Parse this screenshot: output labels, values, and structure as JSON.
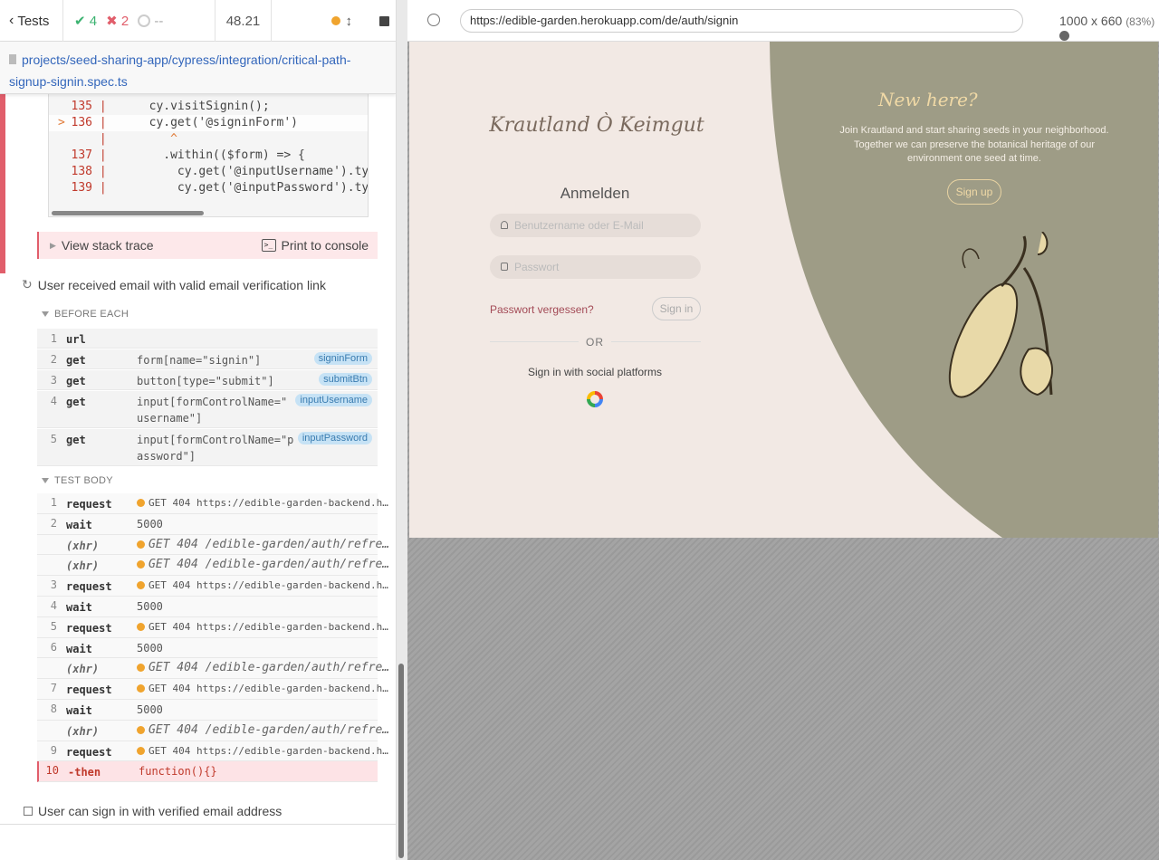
{
  "header": {
    "tests_label": "Tests",
    "passed": "4",
    "failed": "2",
    "pending": "--",
    "duration": "48.21"
  },
  "spec_path": "projects/seed-sharing-app/cypress/integration/critical-path-signup-signin.spec.ts",
  "code_frame": {
    "lines": [
      {
        "num": "135",
        "code": "      cy.visitSignin();"
      },
      {
        "num": "136",
        "code": "      cy.get('@signinForm')"
      },
      {
        "num": "",
        "code": "         ^"
      },
      {
        "num": "137",
        "code": "        .within(($form) => {"
      },
      {
        "num": "138",
        "code": "          cy.get('@inputUsername').type"
      },
      {
        "num": "139",
        "code": "          cy.get('@inputPassword').type"
      }
    ]
  },
  "stack": {
    "view_label": "View stack trace",
    "print_label": "Print to console",
    "term_glyph": ">_"
  },
  "test2_title": "User received email with valid email verification link",
  "before_each": {
    "title": "BEFORE EACH",
    "commands": [
      {
        "n": "1",
        "cmd": "url",
        "msg": "",
        "tag": ""
      },
      {
        "n": "2",
        "cmd": "get",
        "msg": "form[name=\"signin\"]",
        "tag": "signinForm"
      },
      {
        "n": "3",
        "cmd": "get",
        "msg": "button[type=\"submit\"]",
        "tag": "submitBtn"
      },
      {
        "n": "4",
        "cmd": "get",
        "msg": "input[formControlName=\"\nusername\"]",
        "tag": "inputUsername"
      },
      {
        "n": "5",
        "cmd": "get",
        "msg": "input[formControlName=\"p\nassword\"]",
        "tag": "inputPassword"
      }
    ]
  },
  "test_body": {
    "title": "TEST BODY",
    "commands": [
      {
        "n": "1",
        "cmd": "request",
        "msg": "GET 404 https://edible-garden-backend.h…",
        "kind": "req"
      },
      {
        "n": "2",
        "cmd": "wait",
        "msg": "5000",
        "kind": "plain"
      },
      {
        "n": "",
        "cmd": "(xhr)",
        "msg": "GET 404 /edible-garden/auth/refre…",
        "kind": "xhr"
      },
      {
        "n": "",
        "cmd": "(xhr)",
        "msg": "GET 404 /edible-garden/auth/refre…",
        "kind": "xhr"
      },
      {
        "n": "3",
        "cmd": "request",
        "msg": "GET 404 https://edible-garden-backend.h…",
        "kind": "req"
      },
      {
        "n": "4",
        "cmd": "wait",
        "msg": "5000",
        "kind": "plain"
      },
      {
        "n": "5",
        "cmd": "request",
        "msg": "GET 404 https://edible-garden-backend.h…",
        "kind": "req"
      },
      {
        "n": "6",
        "cmd": "wait",
        "msg": "5000",
        "kind": "plain"
      },
      {
        "n": "",
        "cmd": "(xhr)",
        "msg": "GET 404 /edible-garden/auth/refre…",
        "kind": "xhr"
      },
      {
        "n": "7",
        "cmd": "request",
        "msg": "GET 404 https://edible-garden-backend.h…",
        "kind": "req"
      },
      {
        "n": "8",
        "cmd": "wait",
        "msg": "5000",
        "kind": "plain"
      },
      {
        "n": "",
        "cmd": "(xhr)",
        "msg": "GET 404 /edible-garden/auth/refre…",
        "kind": "xhr"
      },
      {
        "n": "9",
        "cmd": "request",
        "msg": "GET 404 https://edible-garden-backend.h…",
        "kind": "req"
      },
      {
        "n": "10",
        "cmd": "-then",
        "msg": "function(){}",
        "kind": "err"
      }
    ]
  },
  "test3_title": "User can sign in with verified email address",
  "aut": {
    "url": "https://edible-garden.herokuapp.com/de/auth/signin",
    "viewport": "1000 x 660",
    "scale": "(83%)"
  },
  "app": {
    "logo": "Krautland Ò Keimgut",
    "title": "Anmelden",
    "username_placeholder": "Benutzername oder E-Mail",
    "password_placeholder": "Passwort",
    "forgot": "Passwort vergessen?",
    "signin": "Sign in",
    "or": "OR",
    "social": "Sign in with social platforms",
    "new_here": "New here?",
    "join": "Join Krautland and start sharing seeds in your neighborhood. Together we can preserve the botanical heritage of our environment one seed at time.",
    "signup": "Sign up"
  },
  "colors": {
    "fail": "#e15e6b",
    "pass": "#3cb371",
    "accent": "#3366bb",
    "panel": "#9e9c86",
    "app_bg": "#f2e9e4"
  }
}
